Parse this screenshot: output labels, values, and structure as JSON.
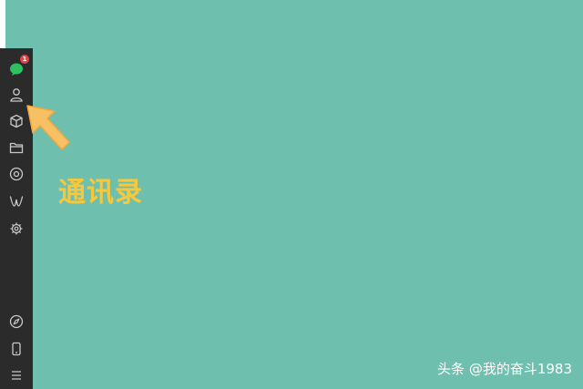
{
  "sidebar": {
    "chat_badge": "1",
    "icons": [
      "chat-icon",
      "contacts-icon",
      "cube-icon",
      "folder-icon",
      "settings-icon",
      "miniprogram-icon",
      "gear-icon",
      "compass-icon",
      "phone-icon",
      "menu-icon"
    ]
  },
  "callout": {
    "text": "通讯录"
  },
  "watermark": {
    "text": "头条 @我的奋斗1983"
  },
  "colors": {
    "background": "#6fbfaf",
    "sidebar": "#2b2b2b",
    "accent": "#f7c83c",
    "chat_green": "#2fc160",
    "badge_red": "#e04444"
  }
}
